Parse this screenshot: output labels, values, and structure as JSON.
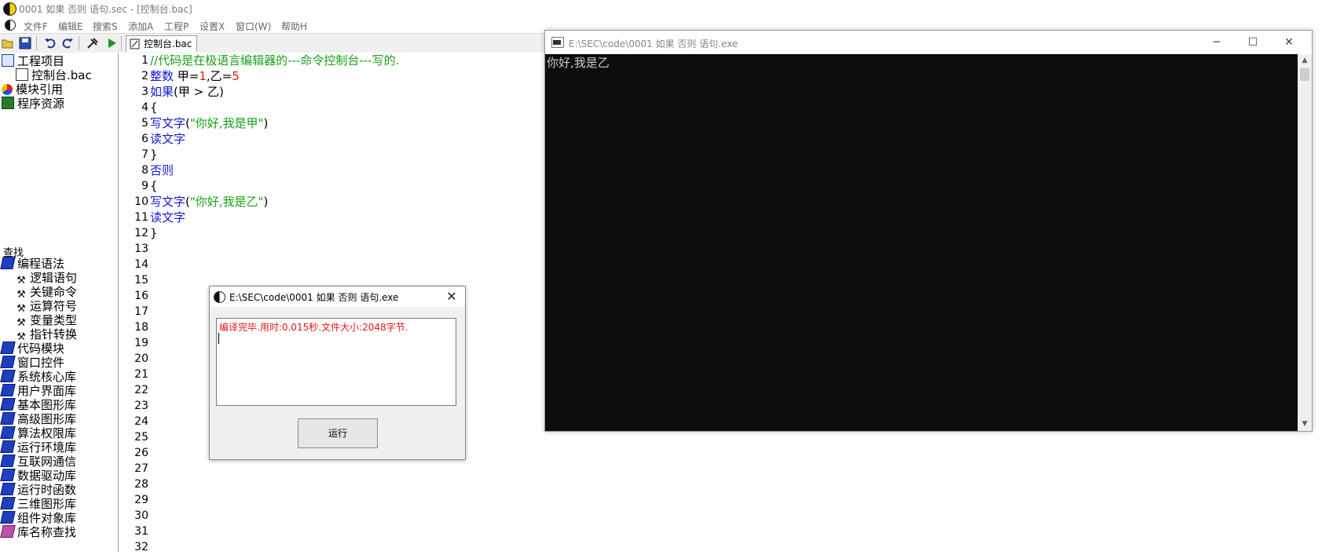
{
  "window": {
    "title": "0001 如果 否则 语句.sec - [控制台.bac]"
  },
  "menu": [
    "文件F",
    "编辑E",
    "搜索S",
    "添加A",
    "工程P",
    "设置X",
    "窗口(W)",
    "帮助H"
  ],
  "toolbar": {
    "icons": [
      "open-folder-icon",
      "save-icon",
      "undo-icon",
      "redo-icon",
      "build-icon",
      "run-icon"
    ],
    "active_tab": "控制台.bac"
  },
  "project_tree": {
    "root": "工程项目",
    "file": "控制台.bac",
    "modules": "模块引用",
    "resources": "程序资源"
  },
  "search": {
    "label": "查找",
    "syntax": "编程语法",
    "syntax_children": [
      "逻辑语句",
      "关键命令",
      "运算符号",
      "变量类型",
      "指针转换"
    ],
    "libraries": [
      "代码模块",
      "窗口控件",
      "系统核心库",
      "用户界面库",
      "基本图形库",
      "高级图形库",
      "算法权限库",
      "运行环境库",
      "互联网通信",
      "数据驱动库",
      "运行时函数",
      "三维图形库",
      "组件对象库"
    ],
    "lib_lookup": "库名称查找"
  },
  "editor": {
    "line_numbers": [
      "1",
      "2",
      "3",
      "4",
      "5",
      "6",
      "7",
      "8",
      "9",
      "10",
      "11",
      "12",
      "13",
      "14",
      "15",
      "16",
      "17",
      "18",
      "19",
      "20",
      "21",
      "22",
      "23",
      "24",
      "25",
      "26",
      "27",
      "28",
      "29",
      "30",
      "31",
      "32"
    ],
    "lines": [
      "//代码是在极语言编辑器的---命令控制台---写的.",
      "整数 甲=1,乙=5",
      "如果(甲 > 乙)",
      "{",
      "写文字(\"你好,我是甲\")",
      "读文字",
      "}",
      "否则",
      "{",
      "写文字(\"你好,我是乙\")",
      "读文字",
      "}"
    ],
    "tokens": {
      "l2_kw": "整数",
      "l2_a": " 甲=",
      "l2_n1": "1",
      "l2_b": ",乙=",
      "l2_n2": "5",
      "l3_kw": "如果",
      "l3_rest": "(甲 > 乙)",
      "l5_kw": "写文字",
      "l5_p1": "(",
      "l5_str": "\"你好,我是甲\"",
      "l5_p2": ")",
      "l6_kw": "读文字",
      "l8_kw": "否则",
      "l10_kw": "写文字",
      "l10_p1": "(",
      "l10_str": "\"你好,我是乙\"",
      "l10_p2": ")",
      "l11_kw": "读文字"
    }
  },
  "console": {
    "title": "E:\\SEC\\code\\0001 如果 否则 语句.exe",
    "output": "你好,我是乙",
    "minimize": "─",
    "maximize": "☐",
    "close": "✕"
  },
  "dialog": {
    "title": "E:\\SEC\\code\\0001 如果 否则 语句.exe",
    "message": "编译完毕.用时:0.015秒.文件大小:2048字节.",
    "run_button": "运行",
    "close": "✕"
  },
  "colors": {
    "keyword": "#1018d8",
    "comment": "#18a018",
    "number": "#e01818",
    "message": "#e01818",
    "console_bg": "#0c0c0c"
  }
}
